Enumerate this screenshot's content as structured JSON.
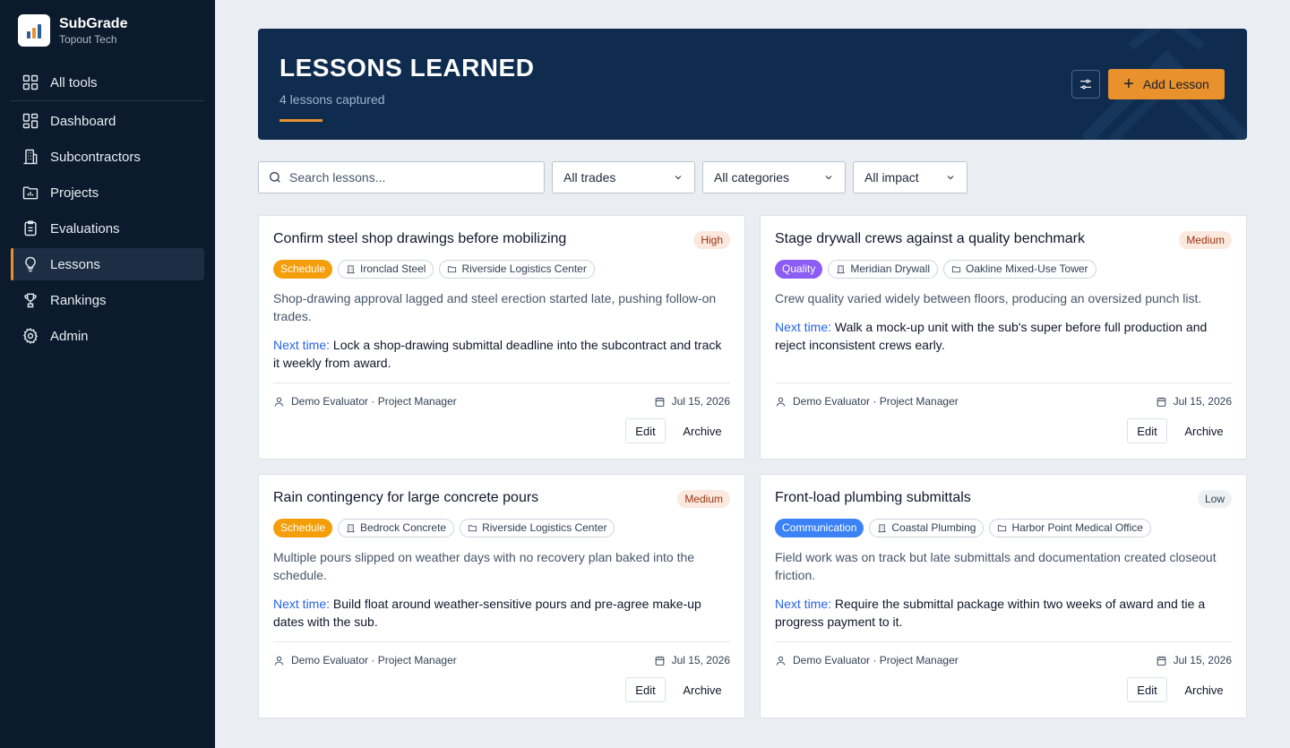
{
  "brand": {
    "name": "SubGrade",
    "org": "Topout Tech"
  },
  "nav": [
    {
      "label": "All tools",
      "icon": "grid-icon",
      "active": false
    },
    {
      "label": "Dashboard",
      "icon": "dashboard-icon",
      "active": false
    },
    {
      "label": "Subcontractors",
      "icon": "building-icon",
      "active": false
    },
    {
      "label": "Projects",
      "icon": "folder-chart-icon",
      "active": false
    },
    {
      "label": "Evaluations",
      "icon": "clipboard-icon",
      "active": false
    },
    {
      "label": "Lessons",
      "icon": "lightbulb-icon",
      "active": true
    },
    {
      "label": "Rankings",
      "icon": "trophy-icon",
      "active": false
    },
    {
      "label": "Admin",
      "icon": "gear-icon",
      "active": false
    }
  ],
  "hero": {
    "title": "LESSONS LEARNED",
    "subtitle": "4 lessons captured",
    "add_label": "Add Lesson"
  },
  "filters": {
    "search_placeholder": "Search lessons...",
    "trade": "All trades",
    "category": "All categories",
    "impact": "All impact"
  },
  "colors": {
    "accent": "#e8912d",
    "schedule": "#f59e0b",
    "quality": "#8b5cf6",
    "communication": "#3b82f6"
  },
  "card_labels": {
    "next_time": "Next time:",
    "edit": "Edit",
    "archive": "Archive"
  },
  "lessons": [
    {
      "title": "Confirm steel shop drawings before mobilizing",
      "impact": "High",
      "category": "Schedule",
      "sub": "Ironclad Steel",
      "project": "Riverside Logistics Center",
      "description": "Shop-drawing approval lagged and steel erection started late, pushing follow-on trades.",
      "next_time": "Lock a shop-drawing submittal deadline into the subcontract and track it weekly from award.",
      "author": "Demo Evaluator · Project Manager",
      "date": "Jul 15, 2026"
    },
    {
      "title": "Stage drywall crews against a quality benchmark",
      "impact": "Medium",
      "category": "Quality",
      "sub": "Meridian Drywall",
      "project": "Oakline Mixed-Use Tower",
      "description": "Crew quality varied widely between floors, producing an oversized punch list.",
      "next_time": "Walk a mock-up unit with the sub's super before full production and reject inconsistent crews early.",
      "author": "Demo Evaluator · Project Manager",
      "date": "Jul 15, 2026"
    },
    {
      "title": "Rain contingency for large concrete pours",
      "impact": "Medium",
      "category": "Schedule",
      "sub": "Bedrock Concrete",
      "project": "Riverside Logistics Center",
      "description": "Multiple pours slipped on weather days with no recovery plan baked into the schedule.",
      "next_time": "Build float around weather-sensitive pours and pre-agree make-up dates with the sub.",
      "author": "Demo Evaluator · Project Manager",
      "date": "Jul 15, 2026"
    },
    {
      "title": "Front-load plumbing submittals",
      "impact": "Low",
      "category": "Communication",
      "sub": "Coastal Plumbing",
      "project": "Harbor Point Medical Office",
      "description": "Field work was on track but late submittals and documentation created closeout friction.",
      "next_time": "Require the submittal package within two weeks of award and tie a progress payment to it.",
      "author": "Demo Evaluator · Project Manager",
      "date": "Jul 15, 2026"
    }
  ]
}
